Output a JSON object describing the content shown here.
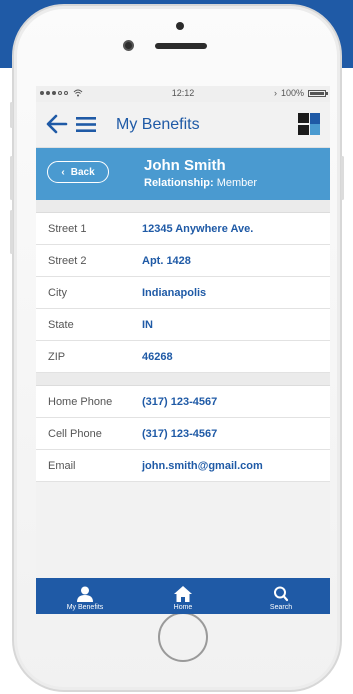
{
  "statusbar": {
    "time": "12:12",
    "battery": "100%"
  },
  "appbar": {
    "title": "My Benefits"
  },
  "member": {
    "back_label": "Back",
    "name": "John Smith",
    "relationship_label": "Relationship:",
    "relationship_value": "Member"
  },
  "address": [
    {
      "label": "Street 1",
      "value": "12345 Anywhere Ave."
    },
    {
      "label": "Street 2",
      "value": "Apt. 1428"
    },
    {
      "label": "City",
      "value": "Indianapolis"
    },
    {
      "label": "State",
      "value": "IN"
    },
    {
      "label": "ZIP",
      "value": "46268"
    }
  ],
  "contact": [
    {
      "label": "Home Phone",
      "value": "(317) 123-4567"
    },
    {
      "label": "Cell Phone",
      "value": "(317) 123-4567"
    },
    {
      "label": "Email",
      "value": "john.smith@gmail.com"
    }
  ],
  "tabs": [
    {
      "label": "My Benefits",
      "icon": "person-icon"
    },
    {
      "label": "Home",
      "icon": "home-icon"
    },
    {
      "label": "Search",
      "icon": "search-icon"
    }
  ],
  "colors": {
    "primary": "#1f5aa6",
    "header": "#4a9ad0",
    "background": "#f2f2f2"
  }
}
